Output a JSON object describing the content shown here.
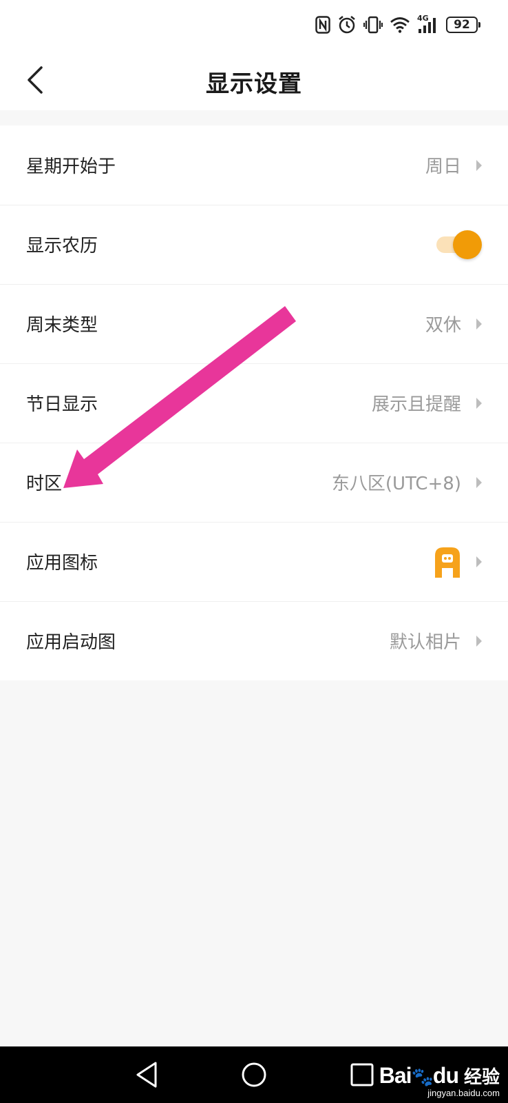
{
  "status_bar": {
    "battery": "92",
    "network": "4G",
    "icons": [
      "nfc-icon",
      "alarm-icon",
      "vibrate-icon",
      "wifi-icon",
      "signal-icon",
      "battery-icon"
    ]
  },
  "header": {
    "title": "显示设置",
    "back_icon": "chevron-left-icon"
  },
  "settings": {
    "week_start": {
      "label": "星期开始于",
      "value": "周日"
    },
    "lunar": {
      "label": "显示农历",
      "enabled": true
    },
    "weekend": {
      "label": "周末类型",
      "value": "双休"
    },
    "holiday": {
      "label": "节日显示",
      "value": "展示且提醒"
    },
    "timezone": {
      "label": "时区",
      "value": "东八区(UTC+8)"
    },
    "app_icon": {
      "label": "应用图标",
      "icon": "app-logo-icon"
    },
    "launch_image": {
      "label": "应用启动图",
      "value": "默认相片"
    }
  },
  "colors": {
    "accent": "#f19b07",
    "accent_light": "#fbe1b8",
    "annotation_arrow": "#e8369a",
    "value_text": "#9a9a9a"
  },
  "nav_bar": {
    "icons": [
      "nav-back-icon",
      "nav-home-icon",
      "nav-recents-icon"
    ]
  },
  "watermark": {
    "brand": "Bai",
    "brand_suffix": "du",
    "text": "经验",
    "url": "jingyan.baidu.com"
  }
}
